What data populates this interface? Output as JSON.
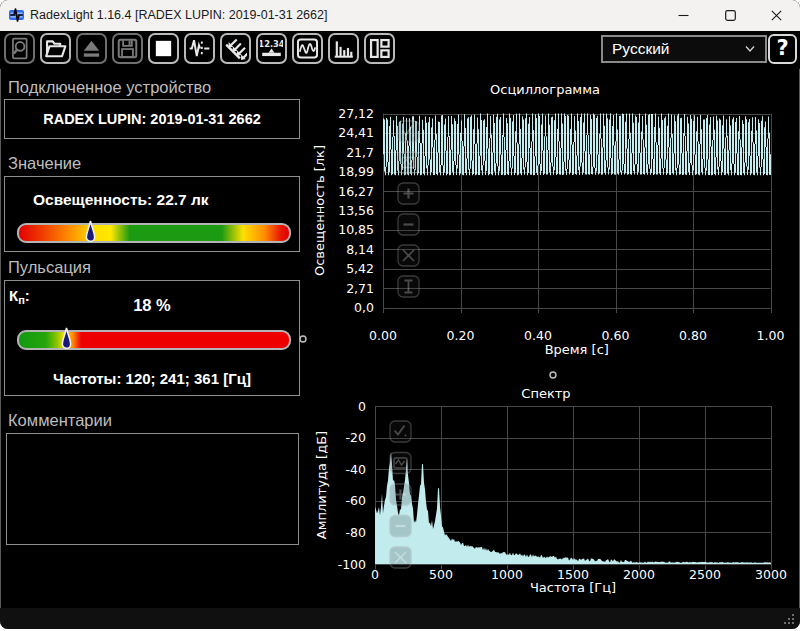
{
  "window": {
    "title": "RadexLight 1.16.4 [RADEX LUPIN: 2019-01-31 2662]",
    "controls": [
      {
        "id": "minimize",
        "icon": "minimize-icon"
      },
      {
        "id": "maximize",
        "icon": "maximize-icon"
      },
      {
        "id": "close",
        "icon": "close-icon"
      }
    ]
  },
  "toolbar": {
    "buttons": [
      {
        "id": "preview",
        "icon": "document-zoom-icon",
        "enabled": false
      },
      {
        "id": "open",
        "icon": "open-folder-icon",
        "enabled": true
      },
      {
        "id": "eject",
        "icon": "eject-icon",
        "enabled": false
      },
      {
        "id": "save",
        "icon": "save-icon",
        "enabled": false
      },
      {
        "id": "stop",
        "icon": "stop-icon",
        "enabled": true
      },
      {
        "id": "pulsation",
        "icon": "pulse-waveform-icon",
        "enabled": true
      },
      {
        "id": "illuminance",
        "icon": "light-rays-icon",
        "enabled": true
      },
      {
        "id": "value-display",
        "icon": "measured-value-icon",
        "enabled": true,
        "text": "12.34"
      },
      {
        "id": "oscillogram",
        "icon": "oscillogram-icon",
        "enabled": true
      },
      {
        "id": "spectrum",
        "icon": "spectrum-bars-icon",
        "enabled": true
      },
      {
        "id": "layout",
        "icon": "panels-icon",
        "enabled": true
      }
    ],
    "language_select": {
      "value": "Русский"
    },
    "help_label": "?"
  },
  "panel": {
    "device": {
      "label": "Подключенное устройство",
      "name": "RADEX LUPIN: 2019-01-31 2662"
    },
    "value": {
      "label": "Значение",
      "reading": "Освещенность: 22.7 лк",
      "marker_fraction": 0.267,
      "gradient": [
        [
          "0%",
          "#e20000"
        ],
        [
          "9%",
          "#f04000"
        ],
        [
          "19%",
          "#ff9000"
        ],
        [
          "28%",
          "#ffdf00"
        ],
        [
          "34%",
          "#ffe800"
        ],
        [
          "41%",
          "#1c9a12"
        ],
        [
          "75%",
          "#1c9a12"
        ],
        [
          "83%",
          "#ffe000"
        ],
        [
          "91%",
          "#ff8c00"
        ],
        [
          "97%",
          "#e81600"
        ],
        [
          "100%",
          "#e20000"
        ]
      ]
    },
    "pulsation": {
      "label": "Пульсация",
      "kp_main": "К",
      "kp_sub": "п",
      "kp_colon": ":",
      "percent": "18 %",
      "frequencies": "Частоты: 120; 241; 361 [Гц]",
      "marker_fraction": 0.178,
      "gradient": [
        [
          "0%",
          "#119a11"
        ],
        [
          "10%",
          "#27a50b"
        ],
        [
          "14%",
          "#8ec400"
        ],
        [
          "17%",
          "#ffe000"
        ],
        [
          "20%",
          "#ff8800"
        ],
        [
          "23%",
          "#ee0000"
        ],
        [
          "100%",
          "#ee0000"
        ]
      ]
    },
    "comments": {
      "label": "Комментарии",
      "text": ""
    }
  },
  "chart_data": [
    {
      "type": "line",
      "title": "Осциллограмма",
      "xlabel": "Время [с]",
      "ylabel": "Освещенность [лк]",
      "xlim": [
        0,
        1
      ],
      "ylim": [
        0,
        27.12
      ],
      "x_ticks": [
        "0.00",
        "0.20",
        "0.40",
        "0.60",
        "0.80",
        "1.00"
      ],
      "y_ticks": [
        "27,12",
        "24,41",
        "21,7",
        "18,99",
        "16,27",
        "13,56",
        "10,85",
        "8,14",
        "5,42",
        "2,71",
        "0,0"
      ],
      "grid": true,
      "overlay_buttons": [
        "check",
        "wave",
        "zoom-in",
        "zoom-out",
        "pan",
        "y-fit"
      ],
      "signal": {
        "mean": 22.7,
        "min": 18.5,
        "max": 27.12,
        "frequencies_hz": [
          120,
          241,
          361
        ],
        "ripple_amplitudes": [
          1.0,
          0.13,
          0.08
        ],
        "peak_sharpness": 1.75,
        "duration_s": 1
      }
    },
    {
      "type": "area",
      "title": "Спектр",
      "xlabel": "Частота [Гц]",
      "ylabel": "Амплитуда [дБ]",
      "xlim": [
        0,
        3000
      ],
      "ylim": [
        -100,
        0
      ],
      "x_ticks": [
        "0",
        "500",
        "1000",
        "1500",
        "2000",
        "2500",
        "3000"
      ],
      "y_ticks": [
        "0",
        "-20",
        "-40",
        "-60",
        "-80",
        "-100"
      ],
      "grid": true,
      "overlay_buttons": [
        "check",
        "wave",
        "zoom-in",
        "zoom-out",
        "pan"
      ],
      "peaks": [
        {
          "hz": 53,
          "db": -56,
          "w": 25
        },
        {
          "hz": 100,
          "db": -48,
          "w": 30
        },
        {
          "hz": 120,
          "db": -29,
          "w": 50
        },
        {
          "hz": 146,
          "db": -50,
          "w": 30
        },
        {
          "hz": 241,
          "db": -33.5,
          "w": 50
        },
        {
          "hz": 361,
          "db": -37,
          "w": 50
        },
        {
          "hz": 482,
          "db": -52,
          "w": 45
        },
        {
          "hz": 560,
          "db": -84,
          "w": 30
        }
      ],
      "noise_floor_db": [
        [
          0,
          -69
        ],
        [
          250,
          -72
        ],
        [
          500,
          -78
        ],
        [
          560,
          -84
        ],
        [
          700,
          -88.5
        ],
        [
          1000,
          -93.5
        ],
        [
          1500,
          -97
        ],
        [
          2000,
          -98.8
        ],
        [
          3000,
          -99.2
        ]
      ]
    }
  ],
  "colors": {
    "waveform": "#c5edf0",
    "spectrum_fill": "#c2ebee",
    "grid": "#484848",
    "chart_text": "#ffffff",
    "marker_fill": "#181878",
    "accent_titlebar_icon": "#2f6af0"
  },
  "statusbar": {
    "text": ""
  }
}
